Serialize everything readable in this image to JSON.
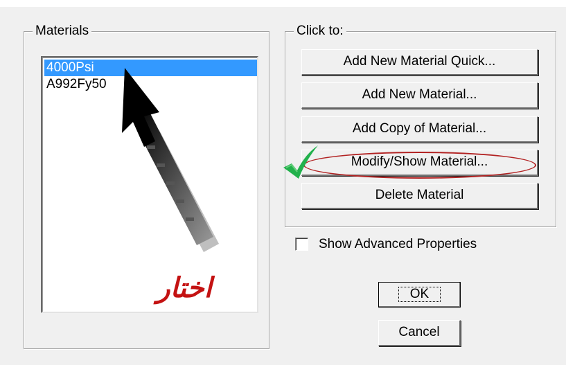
{
  "materials": {
    "group_title": "Materials",
    "items": [
      {
        "label": "4000Psi",
        "selected": true
      },
      {
        "label": "A992Fy50",
        "selected": false
      }
    ]
  },
  "click_to": {
    "group_title": "Click to:",
    "buttons": {
      "add_quick": "Add New Material Quick...",
      "add_new": "Add New Material...",
      "add_copy": "Add Copy of Material...",
      "modify_show": "Modify/Show Material...",
      "delete": "Delete Material"
    }
  },
  "options": {
    "show_advanced_label": "Show Advanced Properties",
    "show_advanced_checked": false
  },
  "dialog_buttons": {
    "ok": "OK",
    "cancel": "Cancel"
  },
  "annotation": {
    "arabic_label": "اختار",
    "arrow_icon": "pointer-arrow-icon",
    "check_icon": "green-check-icon",
    "highlight_color": "#b22222",
    "check_color": "#22b14c",
    "arabic_color": "#c41212"
  },
  "colors": {
    "dialog_bg": "#f0f0f0",
    "selection_bg": "#3399ff"
  }
}
